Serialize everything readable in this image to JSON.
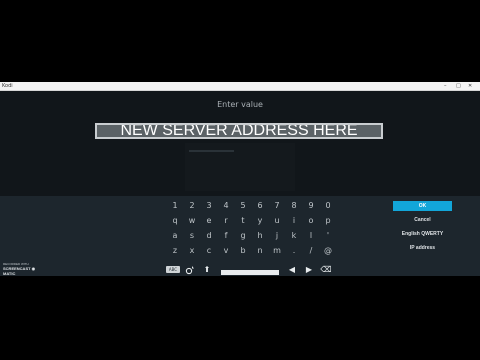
{
  "window": {
    "title": "Kodi",
    "controls": [
      "–",
      "□",
      "✕"
    ]
  },
  "dialog": {
    "heading": "Enter value",
    "value": "NEW SERVER ADDRESS HERE"
  },
  "keyboard": {
    "rows": [
      [
        "1",
        "2",
        "3",
        "4",
        "5",
        "6",
        "7",
        "8",
        "9",
        "0"
      ],
      [
        "q",
        "w",
        "e",
        "r",
        "t",
        "y",
        "u",
        "i",
        "o",
        "p"
      ],
      [
        "a",
        "s",
        "d",
        "f",
        "g",
        "h",
        "j",
        "k",
        "l",
        "'"
      ],
      [
        "z",
        "x",
        "c",
        "v",
        "b",
        "n",
        "m",
        ".",
        "/",
        "@"
      ]
    ],
    "bottom_icons": [
      "symbols-icon",
      "shift-icon",
      "caps-icon",
      "space-bar",
      "left-arrow-icon",
      "right-arrow-icon",
      "backspace-icon"
    ],
    "symbols_label": "ABC",
    "caps_label": "⬆",
    "left_label": "◀",
    "right_label": "▶",
    "backspace_label": "⌫"
  },
  "buttons": {
    "ok": "OK",
    "cancel": "Cancel",
    "layout": "English QWERTY",
    "ip": "IP address"
  },
  "watermark": {
    "small": "RECORDED WITH",
    "main": "SCREENCAST ◉ MATIC"
  },
  "colors": {
    "accent": "#12a6d9",
    "background": "#11161a",
    "keyboard_bg": "#1d262d"
  }
}
